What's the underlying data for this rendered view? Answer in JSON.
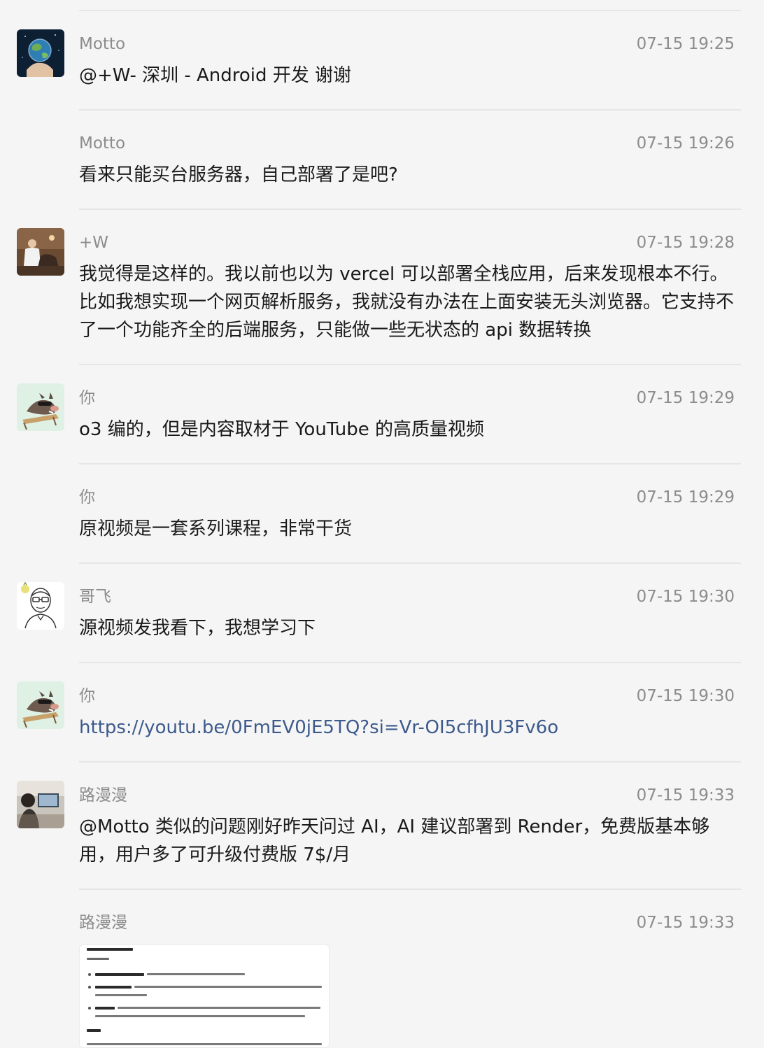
{
  "messages": [
    {
      "sender": "Motto",
      "time": "07-15 19:25",
      "text": "@+W- 深圳 - Android 开发 谢谢",
      "avatar": "earth-hand-avatar-icon"
    },
    {
      "sender": "Motto",
      "time": "07-15 19:26",
      "text": "看来只能买台服务器，自己部署了是吧?"
    },
    {
      "sender": "+W",
      "time": "07-15 19:28",
      "text": "我觉得是这样的。我以前也以为 vercel 可以部署全栈应用，后来发现根本不行。比如我想实现一个网页解析服务，我就没有办法在上面安装无头浏览器。它支持不了一个功能齐全的后端服务，只能做一些无状态的 api 数据转换",
      "avatar": "photo-avatar-icon"
    },
    {
      "sender": "你",
      "time": "07-15 19:29",
      "text": "o3 编的，但是内容取材于 YouTube 的高质量视频",
      "avatar": "boar-deckchair-avatar-icon"
    },
    {
      "sender": "你",
      "time": "07-15 19:29",
      "text": "原视频是一套系列课程，非常干货"
    },
    {
      "sender": "哥飞",
      "time": "07-15 19:30",
      "text": "源视频发我看下，我想学习下",
      "avatar": "glasses-man-avatar-icon"
    },
    {
      "sender": "你",
      "time": "07-15 19:30",
      "text": "https://youtu.be/0FmEV0jE5TQ?si=Vr-OI5cfhJU3Fv6o",
      "avatar": "boar-deckchair-avatar-icon"
    },
    {
      "sender": "路漫漫",
      "time": "07-15 19:33",
      "text": "@Motto 类似的问题刚好昨天问过 AI，AI 建议部署到 Render，免费版基本够用，用户多了可升级付费版 7$/月",
      "avatar": "desk-photo-avatar-icon"
    },
    {
      "sender": "路漫漫",
      "time": "07-15 19:33",
      "attachment": "screenshot-image-thumbnail"
    }
  ],
  "colors": {
    "background": "#f5f5f5",
    "divider": "#e6e6e6",
    "meta_text": "#8c8c8c",
    "body_text": "#1a1a1a",
    "link": "#3d5a8c"
  }
}
